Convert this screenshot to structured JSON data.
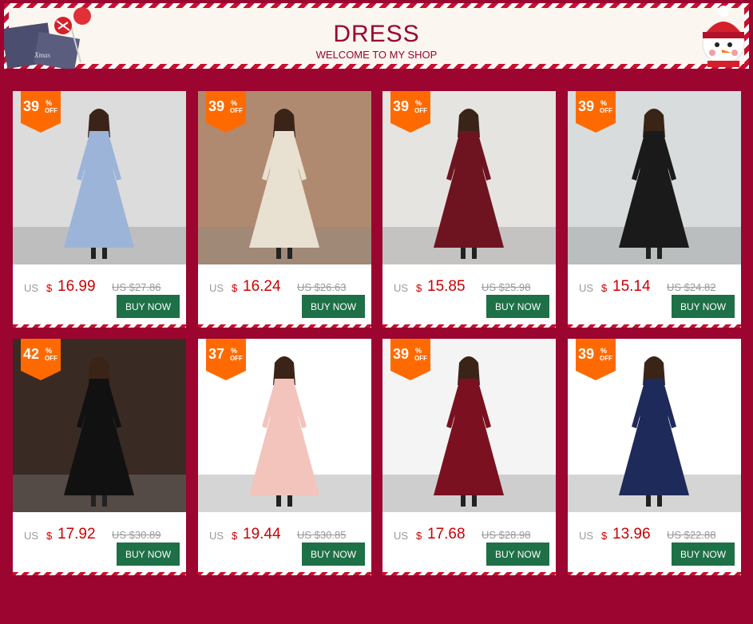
{
  "banner": {
    "title": "DRESS",
    "subtitle": "WELCOME TO MY SHOP",
    "deco_left_text": "Xmas"
  },
  "products": [
    {
      "discount": "39",
      "pct": "%",
      "off": "OFF",
      "currency": "US",
      "sign": "$",
      "price": "16.99",
      "old_price": "US $27.86",
      "button": "BUY NOW",
      "dress_color": "#9bb4d8",
      "bg_color": "#dcdcdc"
    },
    {
      "discount": "39",
      "pct": "%",
      "off": "OFF",
      "currency": "US",
      "sign": "$",
      "price": "16.24",
      "old_price": "US $26.63",
      "button": "BUY NOW",
      "dress_color": "#e8e0d0",
      "bg_color": "#b08a70"
    },
    {
      "discount": "39",
      "pct": "%",
      "off": "OFF",
      "currency": "US",
      "sign": "$",
      "price": "15.85",
      "old_price": "US $25.98",
      "button": "BUY NOW",
      "dress_color": "#6e1420",
      "bg_color": "#e6e4e0"
    },
    {
      "discount": "39",
      "pct": "%",
      "off": "OFF",
      "currency": "US",
      "sign": "$",
      "price": "15.14",
      "old_price": "US $24.82",
      "button": "BUY NOW",
      "dress_color": "#1a1a1a",
      "bg_color": "#d8dcdc"
    },
    {
      "discount": "42",
      "pct": "%",
      "off": "OFF",
      "currency": "US",
      "sign": "$",
      "price": "17.92",
      "old_price": "US $30.89",
      "button": "BUY NOW",
      "dress_color": "#111111",
      "bg_color": "#3a2a24"
    },
    {
      "discount": "37",
      "pct": "%",
      "off": "OFF",
      "currency": "US",
      "sign": "$",
      "price": "19.44",
      "old_price": "US $30.85",
      "button": "BUY NOW",
      "dress_color": "#f2c4bc",
      "bg_color": "#ffffff"
    },
    {
      "discount": "39",
      "pct": "%",
      "off": "OFF",
      "currency": "US",
      "sign": "$",
      "price": "17.68",
      "old_price": "US $28.98",
      "button": "BUY NOW",
      "dress_color": "#7a1020",
      "bg_color": "#f4f4f4"
    },
    {
      "discount": "39",
      "pct": "%",
      "off": "OFF",
      "currency": "US",
      "sign": "$",
      "price": "13.96",
      "old_price": "US $22.88",
      "button": "BUY NOW",
      "dress_color": "#1e2a5a",
      "bg_color": "#ffffff"
    }
  ],
  "colors": {
    "background": "#9b0530",
    "badge": "#ff6a00",
    "button": "#1e7047",
    "price": "#cc0000"
  }
}
